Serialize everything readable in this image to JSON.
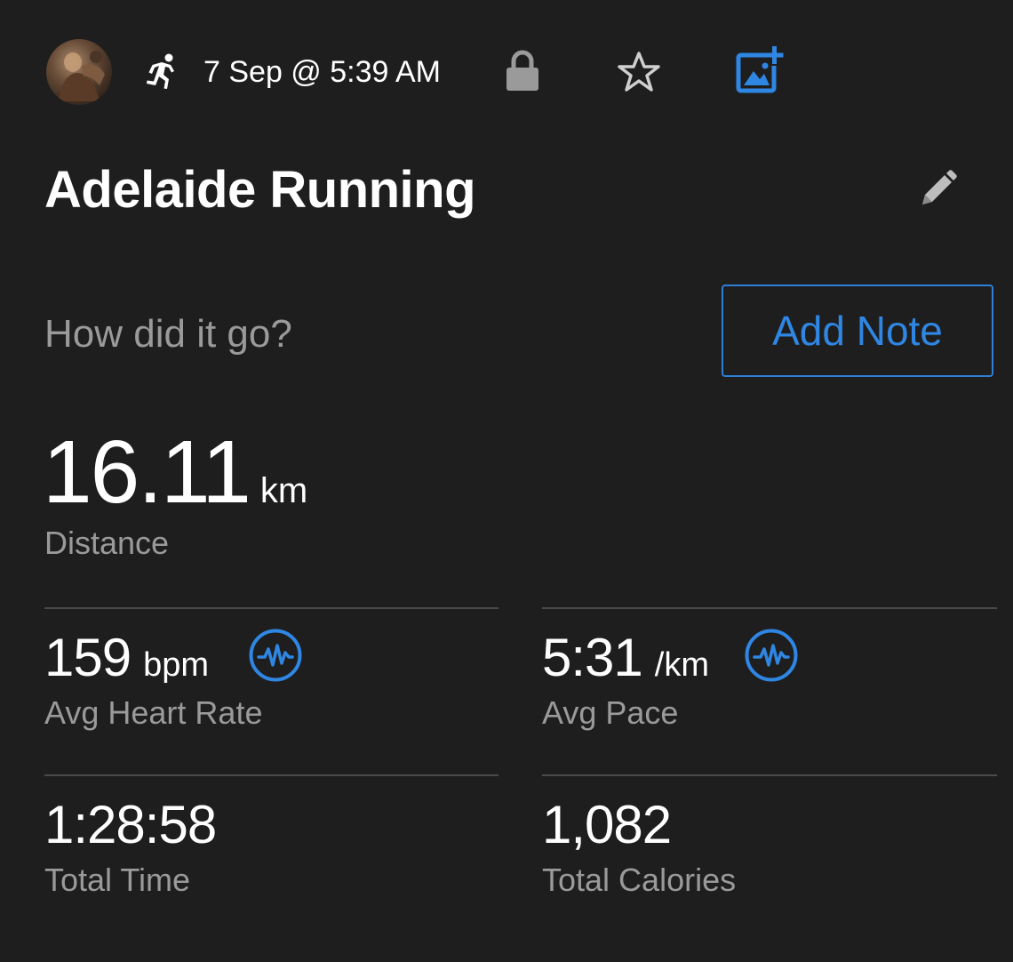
{
  "header": {
    "date_time": "7 Sep @ 5:39 AM",
    "activity_icon": "running-person-icon",
    "privacy_icon": "lock-icon",
    "favorite_icon": "star-outline-icon",
    "add_photo_icon": "add-photo-icon"
  },
  "activity": {
    "title": "Adelaide Running"
  },
  "note": {
    "prompt": "How did it go?",
    "button_label": "Add Note"
  },
  "distance": {
    "value": "16.11",
    "unit": "km",
    "label": "Distance"
  },
  "stats": {
    "heart_rate": {
      "value": "159",
      "unit": "bpm",
      "label": "Avg Heart Rate"
    },
    "pace": {
      "value": "5:31",
      "unit": "/km",
      "label": "Avg Pace"
    },
    "time": {
      "value": "1:28:58",
      "label": "Total Time"
    },
    "calories": {
      "value": "1,082",
      "label": "Total Calories"
    }
  },
  "colors": {
    "background": "#1e1e1e",
    "accent": "#2f86e3",
    "secondary_text": "#9a9a9a",
    "divider": "#4a4a4a"
  }
}
